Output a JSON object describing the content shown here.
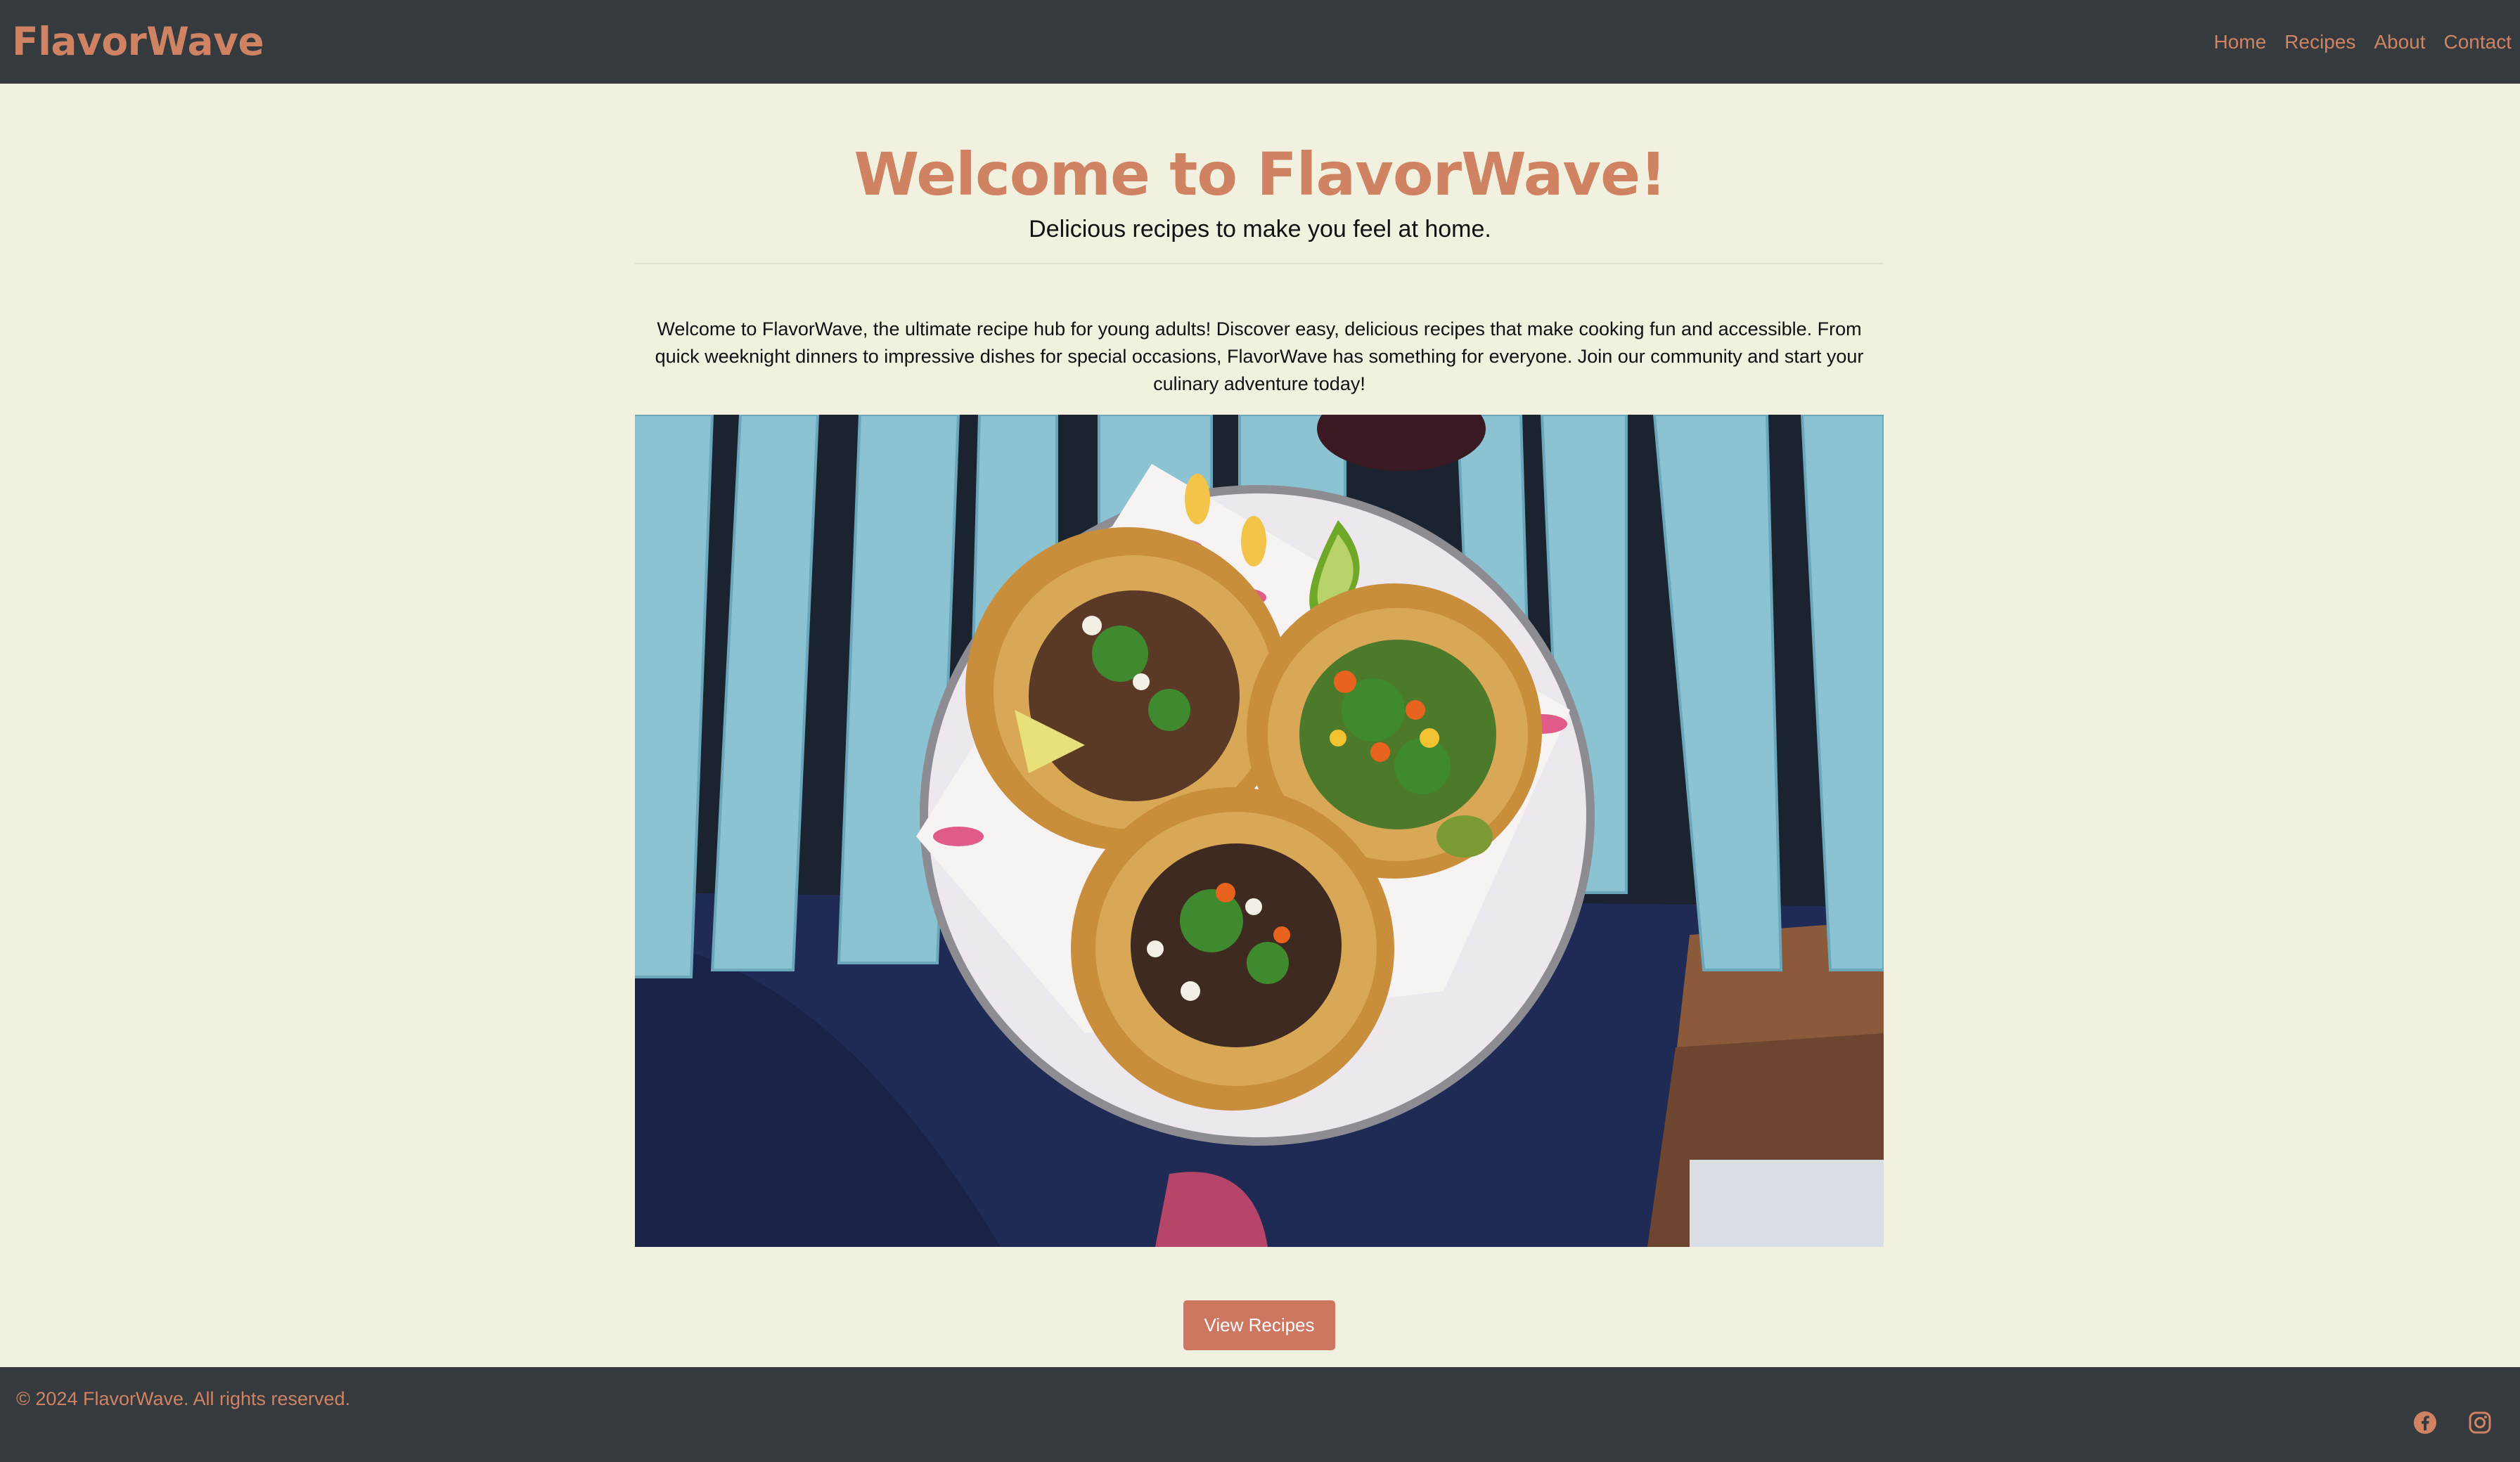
{
  "header": {
    "brand": "FlavorWave",
    "nav": [
      {
        "label": "Home"
      },
      {
        "label": "Recipes"
      },
      {
        "label": "About"
      },
      {
        "label": "Contact"
      }
    ]
  },
  "hero": {
    "title": "Welcome to FlavorWave!",
    "subtitle": "Delicious recipes to make you feel at home.",
    "intro": "Welcome to FlavorWave, the ultimate recipe hub for young adults! Discover easy, delicious recipes that make cooking fun and accessible. From quick weeknight dinners to impressive dishes for special occasions, FlavorWave has something for everyone. Join our community and start your culinary adventure today!",
    "image": "photo of three tacos on a plate on a blue slatted table",
    "cta_label": "View Recipes"
  },
  "footer": {
    "copyright": "© 2024 FlavorWave. All rights reserved.",
    "social": [
      {
        "icon": "facebook-icon"
      },
      {
        "icon": "instagram-icon"
      }
    ]
  },
  "colors": {
    "accent": "#d08363",
    "header_bg": "#343a3e",
    "page_bg": "#f2f0de",
    "button_bg": "#cd7660"
  }
}
